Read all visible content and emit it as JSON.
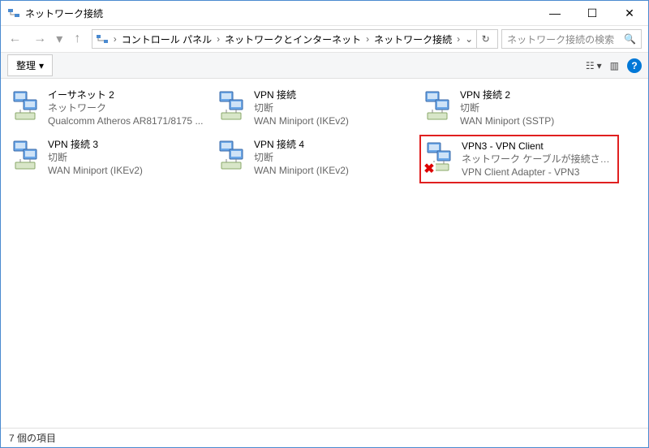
{
  "window": {
    "title": "ネットワーク接続"
  },
  "titlebar_controls": {
    "min": "—",
    "max": "☐",
    "close": "✕"
  },
  "nav": {
    "back": "←",
    "forward": "→",
    "dropdown": "▾",
    "up": "↑"
  },
  "breadcrumbs": {
    "sep": "›",
    "items": [
      "コントロール パネル",
      "ネットワークとインターネット",
      "ネットワーク接続"
    ],
    "dropdown": "⌄",
    "refresh": "↻"
  },
  "search": {
    "placeholder": "ネットワーク接続の検索",
    "icon": "🔍"
  },
  "toolbar": {
    "organize": "整理",
    "dropdown": "▾",
    "view_icon": "☷",
    "preview_icon": "▥",
    "help": "?"
  },
  "items": [
    {
      "name": "イーサネット 2",
      "line2": "ネットワーク",
      "line3": "Qualcomm Atheros AR8171/8175 ...",
      "disconnected": false,
      "highlight": false
    },
    {
      "name": "VPN 接続",
      "line2": "切断",
      "line3": "WAN Miniport (IKEv2)",
      "disconnected": false,
      "highlight": false
    },
    {
      "name": "VPN 接続 2",
      "line2": "切断",
      "line3": "WAN Miniport (SSTP)",
      "disconnected": false,
      "highlight": false
    },
    {
      "name": "VPN 接続 3",
      "line2": "切断",
      "line3": "WAN Miniport (IKEv2)",
      "disconnected": false,
      "highlight": false
    },
    {
      "name": "VPN 接続 4",
      "line2": "切断",
      "line3": "WAN Miniport (IKEv2)",
      "disconnected": false,
      "highlight": false
    },
    {
      "name": "VPN3 - VPN Client",
      "line2": "ネットワーク ケーブルが接続されていま...",
      "line3": "VPN Client Adapter - VPN3",
      "disconnected": true,
      "highlight": true
    }
  ],
  "statusbar": {
    "text": "7 個の項目"
  },
  "overlay_x": "✖"
}
